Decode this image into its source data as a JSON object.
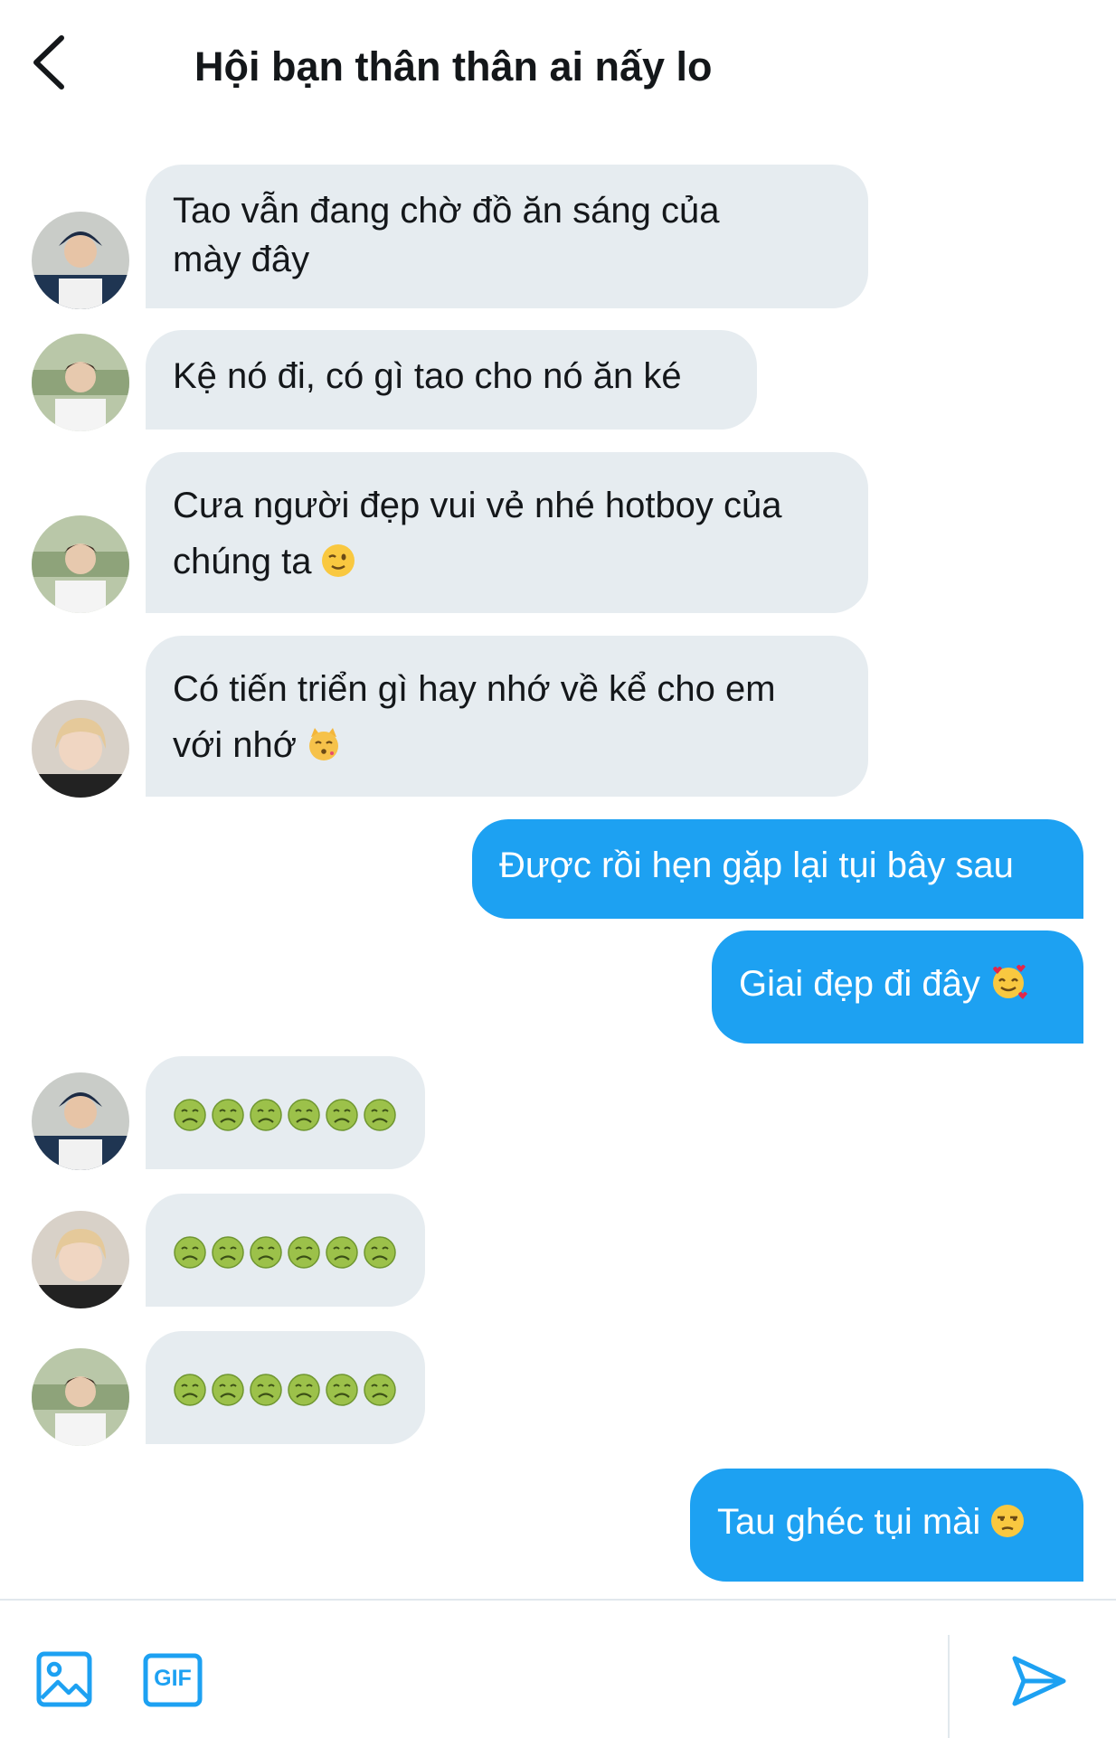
{
  "header": {
    "title": "Hội bạn thân thân ai nấy lo",
    "back_icon": "chevron-left-icon"
  },
  "messages": [
    {
      "direction": "incoming",
      "avatar": "avatar-1",
      "lines": [
        "Tao vẫn đang chờ đồ ăn sáng của",
        "mày đây"
      ]
    },
    {
      "direction": "incoming",
      "avatar": "avatar-2",
      "lines": [
        "Kệ nó đi, có gì tao cho nó ăn ké"
      ]
    },
    {
      "direction": "incoming",
      "avatar": "avatar-2",
      "lines": [
        "Cưa người đẹp vui vẻ nhé hotboy của",
        "chúng ta"
      ],
      "emoji": "winking-face-emoji"
    },
    {
      "direction": "incoming",
      "avatar": "avatar-3",
      "lines": [
        "Có tiến triển gì hay nhớ về kể cho em",
        "với nhớ"
      ],
      "emoji": "kissing-cat-emoji"
    },
    {
      "direction": "outgoing",
      "lines": [
        "Được rồi hẹn gặp lại tụi bây sau"
      ]
    },
    {
      "direction": "outgoing",
      "lines": [
        "Giai đẹp đi đây"
      ],
      "emoji": "smiling-face-with-hearts-emoji"
    },
    {
      "direction": "incoming",
      "avatar": "avatar-1",
      "emoji_count": 6,
      "emoji": "nauseated-face-emoji"
    },
    {
      "direction": "incoming",
      "avatar": "avatar-3",
      "emoji_count": 6,
      "emoji": "nauseated-face-emoji"
    },
    {
      "direction": "incoming",
      "avatar": "avatar-2",
      "emoji_count": 6,
      "emoji": "nauseated-face-emoji"
    },
    {
      "direction": "outgoing",
      "lines": [
        "Tau ghéc tụi mài"
      ],
      "emoji": "unamused-face-emoji"
    }
  ],
  "composer": {
    "image_icon": "image-icon",
    "gif_label": "GIF",
    "send_icon": "send-icon"
  },
  "colors": {
    "outgoing_bubble": "#1da1f2",
    "incoming_bubble": "#e6ecf0",
    "accent": "#1da1f2"
  }
}
